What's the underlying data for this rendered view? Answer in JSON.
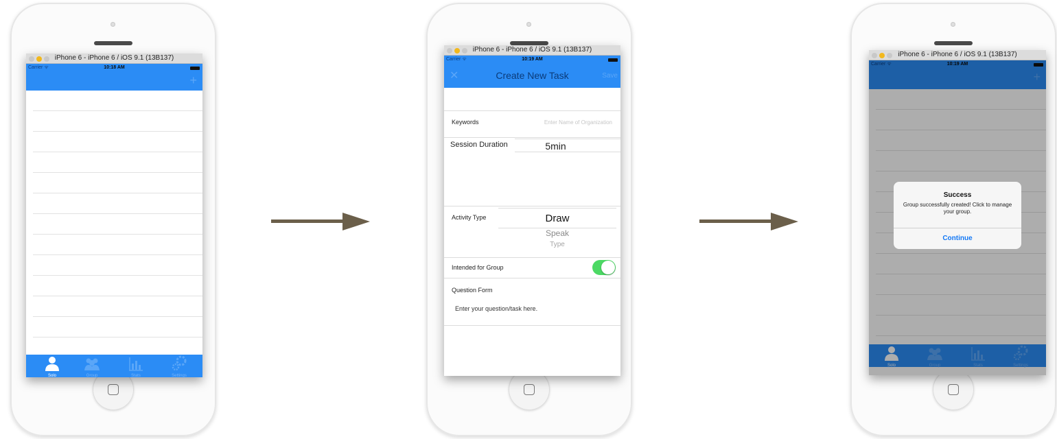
{
  "simulator": {
    "title_1": "iPhone 6 - iPhone 6 / iOS 9.1 (13B137)",
    "title_2": "iPhone 6 - iPhone 6 / iOS 9.1 (13B137)",
    "title_3": "iPhone 6 - iPhone 6 / iOS 9.1 (13B137)"
  },
  "status": {
    "carrier": "Carrier",
    "time_1": "10:18 AM",
    "time_2": "10:19 AM",
    "time_3": "10:19 AM"
  },
  "tabs": [
    {
      "label": "Solo",
      "icon": "person-icon"
    },
    {
      "label": "Group",
      "icon": "group-icon"
    },
    {
      "label": "Stats",
      "icon": "stats-icon"
    },
    {
      "label": "Settings",
      "icon": "gear-icon"
    }
  ],
  "form": {
    "title": "Create New Task",
    "save_label": "Save",
    "keywords_label": "Keywords",
    "keywords_placeholder": "Enter Name of Organization",
    "session_label": "Session Duration",
    "session_value": "5min",
    "activity_label": "Activity Type",
    "activity_options": [
      "Draw",
      "Speak",
      "Type"
    ],
    "group_label": "Intended for Group",
    "group_on": true,
    "question_label": "Question Form",
    "question_placeholder": "Enter your question/task here."
  },
  "alert": {
    "title": "Success",
    "message": "Group successfully created! Click to manage your group.",
    "button": "Continue"
  },
  "colors": {
    "nav_blue": "#2b8cf5",
    "toggle_green": "#4cd964",
    "arrow": "#6b5f4a"
  }
}
